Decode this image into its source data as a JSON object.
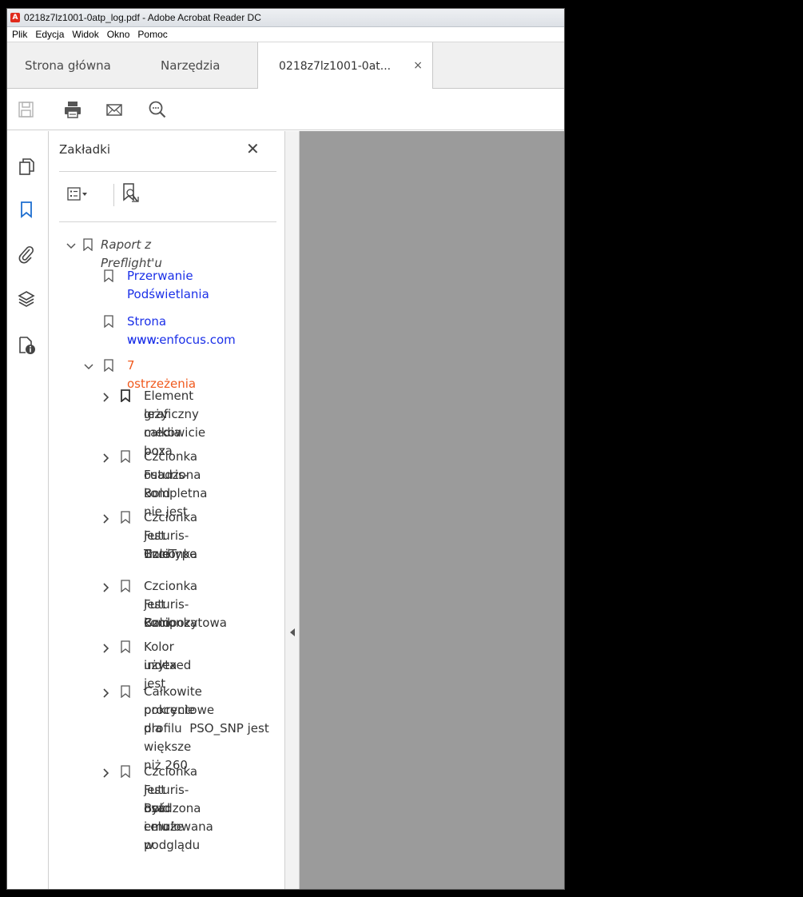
{
  "window": {
    "title": "0218z7lz1001-0atp_log.pdf - Adobe Acrobat Reader DC"
  },
  "menu": [
    "Plik",
    "Edycja",
    "Widok",
    "Okno",
    "Pomoc"
  ],
  "tabs": {
    "home": "Strona główna",
    "tools": "Narzędzia",
    "document": "0218z7lz1001-0at...",
    "close": "×"
  },
  "panel": {
    "title": "Zakładki",
    "close": "✕"
  },
  "bookmarks": {
    "root": "Raport z Preflight'u",
    "item1": [
      "Przerwanie",
      "Podświetlania"
    ],
    "item2": [
      "Strona www:",
      "www.enfocus.com"
    ],
    "warnings": "7 ostrzeżenia",
    "w1": [
      "Element graficzny",
      "leży całkowicie poza",
      "media box"
    ],
    "w2": [
      "Czcionka osadzona",
      "Futuris-Bold nie jest",
      "kompletna"
    ],
    "w3": [
      "Czcionka Futuris-Bold",
      "jest Czcionka",
      "TrueType"
    ],
    "w4": [
      "Czcionka Futuris-Bold",
      "jest Czcionka",
      "kompozytowa"
    ],
    "w5": [
      "Kolor indexed jest",
      "użyta"
    ],
    "w6": [
      "Całkowite pokrycie",
      "procentowe dla",
      "profilu  PSO_SNP jest",
      "większe niż 260"
    ],
    "w7": [
      "Czcionka Futuris-Bold",
      "jest osadzona i może",
      "być emulowana w",
      "celu podglądu"
    ]
  },
  "colors": {
    "link": "#1b30e8",
    "warning": "#f05a1e",
    "docarea": "#9b9b9b"
  }
}
